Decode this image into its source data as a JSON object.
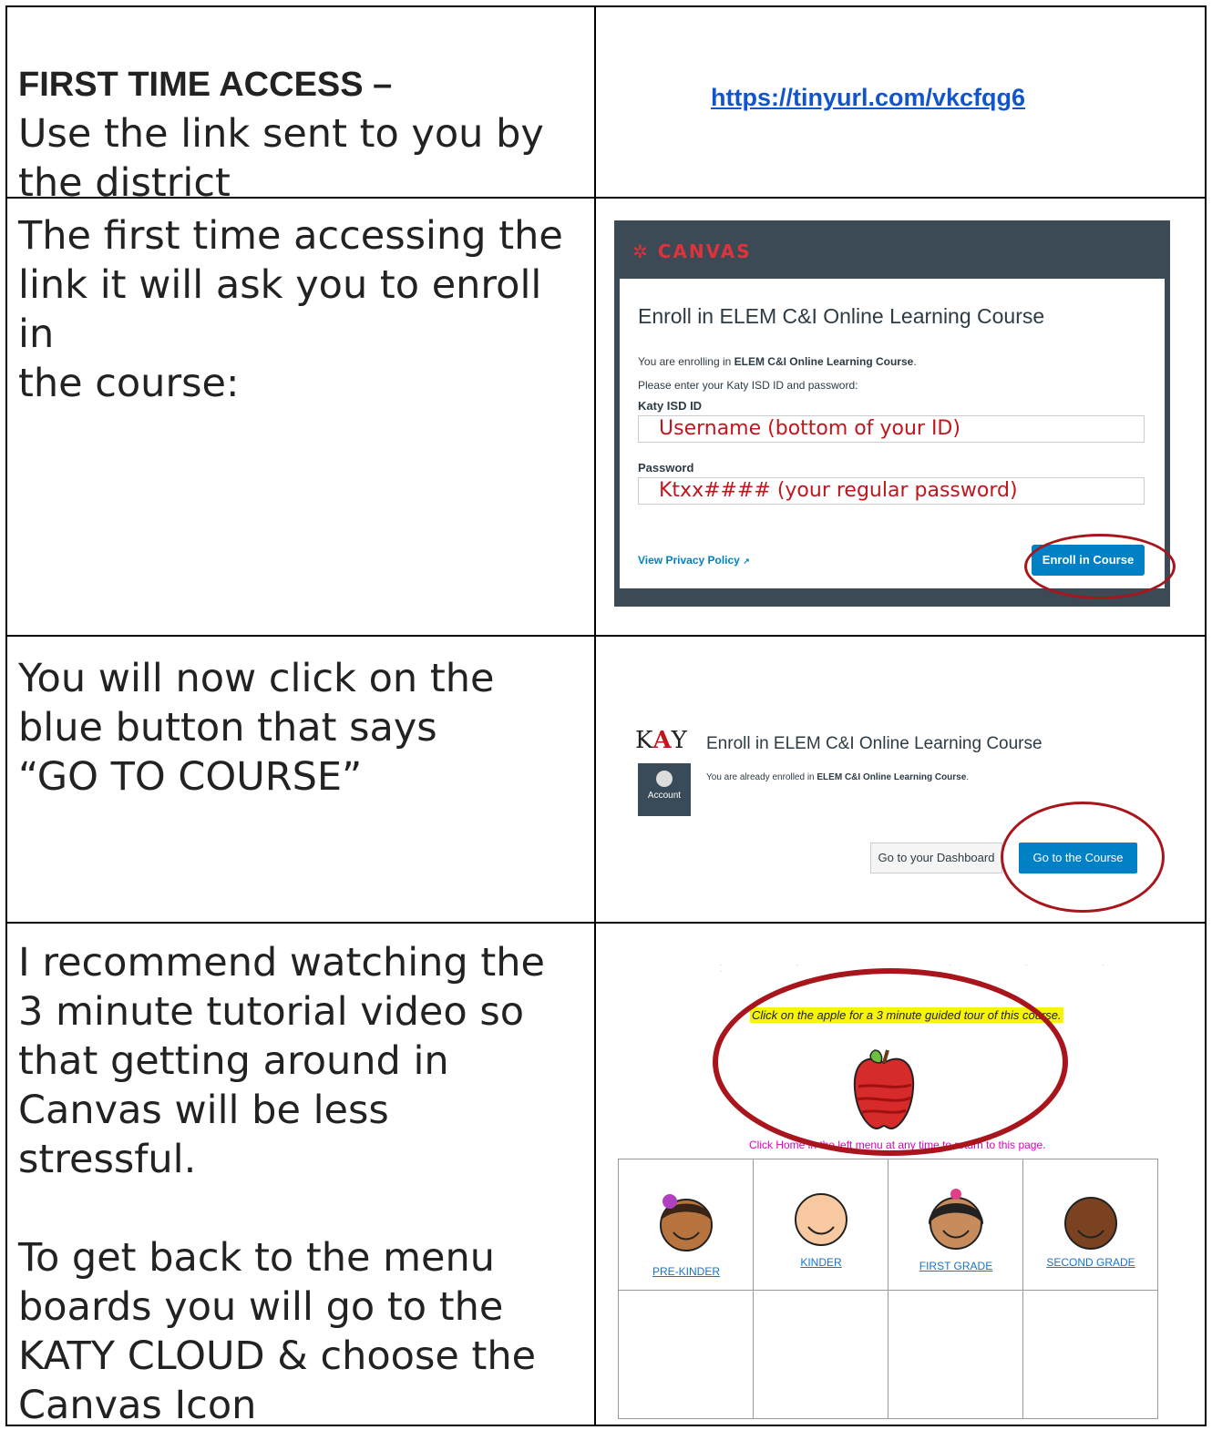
{
  "row1": {
    "heading": "FIRST TIME ACCESS –",
    "line1": "Use the link sent to you by",
    "line2": "the district",
    "link": "https://tinyurl.com/vkcfqg6"
  },
  "row2": {
    "line1": "The first time accessing the",
    "line2": "link it will ask you to enroll in",
    "line3": "the course:",
    "canvas": {
      "brand": "CANVAS",
      "title": "Enroll in ELEM C&I Online Learning Course",
      "enrolling_prefix": "You are enrolling in ",
      "enrolling_course": "ELEM C&I Online Learning Course",
      "enrolling_suffix": ".",
      "prompt": "Please enter your Katy ISD ID and password:",
      "id_label": "Katy ISD ID",
      "id_value": "Username (bottom of your ID)",
      "password_label": "Password",
      "password_value": "Ktxx####  (your regular password)",
      "privacy": "View Privacy Policy",
      "enroll_button": "Enroll in Course"
    }
  },
  "row3": {
    "line1": "You will now click on the",
    "line2": "blue button that says",
    "line3": "“GO TO COURSE”",
    "shot": {
      "logo_k": "K",
      "logo_a": "A",
      "logo_y": "Y",
      "title": "Enroll in ELEM C&I Online Learning Course",
      "already_prefix": "You are already enrolled in ",
      "already_course": "ELEM C&I Online Learning Course",
      "already_suffix": ".",
      "account": "Account",
      "dashboard_button": "Go to your Dashboard",
      "course_button": "Go to the Course"
    }
  },
  "row4": {
    "p1_line1": "I recommend watching the",
    "p1_line2": "3 minute tutorial video so",
    "p1_line3": "that getting around in",
    "p1_line4": "Canvas will be less stressful.",
    "p2_line1": "To get back to the menu",
    "p2_line2": "boards you will go to the",
    "p2_line3": "KATY CLOUD & choose the",
    "p2_line4": "Canvas Icon",
    "tour": {
      "highlight": "Click on the apple for a 3 minute guided tour of this course.",
      "home_note": "Click Home in the left menu at any time to return to this page.",
      "grades": [
        "PRE-KINDER",
        "KINDER",
        "FIRST GRADE",
        "SECOND GRADE"
      ]
    }
  },
  "colors": {
    "canvas_header": "#3b4a55",
    "canvas_red": "#e0323b",
    "button_blue": "#0081c6",
    "annotation_red": "#a8151c",
    "link_blue": "#1155cc",
    "highlight_yellow": "#f5f505",
    "pink_note": "#e000c0"
  }
}
